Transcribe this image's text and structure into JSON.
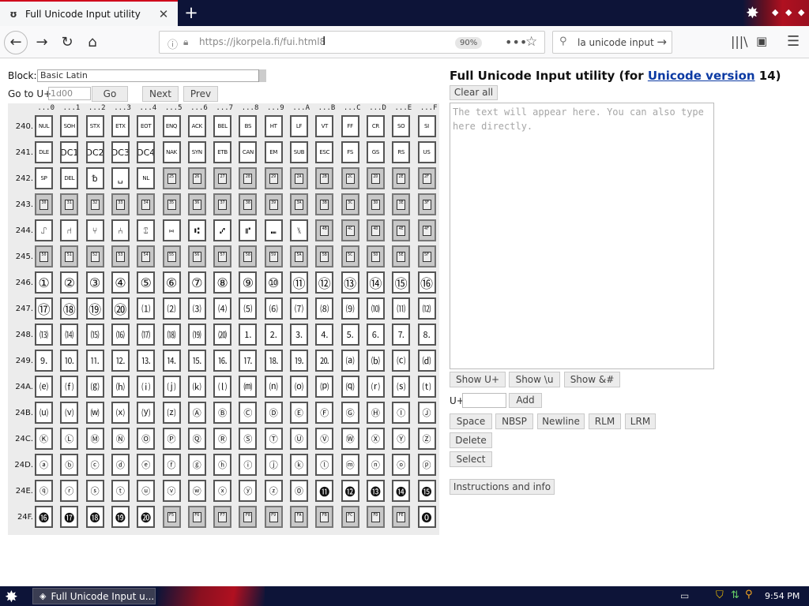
{
  "browser": {
    "tab_title": "Full Unicode Input utility",
    "url": "https://jkorpela.fi/fui.html8",
    "zoom": "90%",
    "search_text": "la unicode input"
  },
  "page": {
    "block_label": "Block:",
    "block_value": "Basic Latin",
    "goto_label": "Go to U+",
    "goto_placeholder": "1d00",
    "go_label": "Go",
    "next_label": "Next",
    "prev_label": "Prev",
    "title_prefix": "Full Unicode Input utility (for ",
    "title_link": "Unicode version",
    "title_suffix": " 14)",
    "clear_label": "Clear all",
    "textarea_placeholder": "The text will appear here. You can also type here directly.",
    "show_u_label": "Show U+",
    "show_esc_label": "Show \\u",
    "show_ent_label": "Show &#",
    "uplus_label": "U+",
    "add_label": "Add",
    "space_label": "Space",
    "nbsp_label": "NBSP",
    "newline_label": "Newline",
    "rlm_label": "RLM",
    "lrm_label": "LRM",
    "delete_label": "Delete",
    "select_label": "Select",
    "instructions_label": "Instructions and info"
  },
  "grid": {
    "col_headers": [
      "...0",
      "...1",
      "...2",
      "...3",
      "...4",
      "...5",
      "...6",
      "...7",
      "...8",
      "...9",
      "...A",
      "...B",
      "...C",
      "...D",
      "...E",
      "...F"
    ],
    "rows": [
      {
        "label": "240.",
        "cells": [
          "NUL",
          "SOH",
          "STX",
          "ETX",
          "EOT",
          "ENQ",
          "ACK",
          "BEL",
          "BS",
          "HT",
          "LF",
          "VT",
          "FF",
          "CR",
          "SO",
          "SI"
        ]
      },
      {
        "label": "241.",
        "cells": [
          "DLE",
          "DC1",
          "DC2",
          "DC3",
          "DC4",
          "NAK",
          "SYN",
          "ETB",
          "CAN",
          "EM",
          "SUB",
          "ESC",
          "FS",
          "GS",
          "RS",
          "US"
        ]
      },
      {
        "label": "242.",
        "cells": [
          "SP",
          "DEL",
          "␢",
          "␣",
          "NL",
          "#2425",
          "#2426",
          "#2427",
          "#2428",
          "#2429",
          "#242A",
          "#242B",
          "#242C",
          "#242D",
          "#242E",
          "#242F"
        ]
      },
      {
        "label": "243.",
        "cells": [
          "#2430",
          "#2431",
          "#2432",
          "#2433",
          "#2434",
          "#2435",
          "#2436",
          "#2437",
          "#2438",
          "#2439",
          "#243A",
          "#243B",
          "#243C",
          "#243D",
          "#243E",
          "#243F"
        ]
      },
      {
        "label": "244.",
        "cells": [
          "⑀",
          "⑁",
          "⑂",
          "⑃",
          "⑄",
          "⑅",
          "⑆",
          "⑇",
          "⑈",
          "⑉",
          "⑊",
          "#244B",
          "#244C",
          "#244D",
          "#244E",
          "#244F"
        ]
      },
      {
        "label": "245.",
        "cells": [
          "#2450",
          "#2451",
          "#2452",
          "#2453",
          "#2454",
          "#2455",
          "#2456",
          "#2457",
          "#2458",
          "#2459",
          "#245A",
          "#245B",
          "#245C",
          "#245D",
          "#245E",
          "#245F"
        ]
      },
      {
        "label": "246.",
        "cells": [
          "①",
          "②",
          "③",
          "④",
          "⑤",
          "⑥",
          "⑦",
          "⑧",
          "⑨",
          "⑩",
          "⑪",
          "⑫",
          "⑬",
          "⑭",
          "⑮",
          "⑯"
        ]
      },
      {
        "label": "247.",
        "cells": [
          "⑰",
          "⑱",
          "⑲",
          "⑳",
          "⑴",
          "⑵",
          "⑶",
          "⑷",
          "⑸",
          "⑹",
          "⑺",
          "⑻",
          "⑼",
          "⑽",
          "⑾",
          "⑿"
        ]
      },
      {
        "label": "248.",
        "cells": [
          "⒀",
          "⒁",
          "⒂",
          "⒃",
          "⒄",
          "⒅",
          "⒆",
          "⒇",
          "⒈",
          "⒉",
          "⒊",
          "⒋",
          "⒌",
          "⒍",
          "⒎",
          "⒏"
        ]
      },
      {
        "label": "249.",
        "cells": [
          "⒐",
          "⒑",
          "⒒",
          "⒓",
          "⒔",
          "⒕",
          "⒖",
          "⒗",
          "⒘",
          "⒙",
          "⒚",
          "⒛",
          "⒜",
          "⒝",
          "⒞",
          "⒟"
        ]
      },
      {
        "label": "24A.",
        "cells": [
          "⒠",
          "⒡",
          "⒢",
          "⒣",
          "⒤",
          "⒥",
          "⒦",
          "⒧",
          "⒨",
          "⒩",
          "⒪",
          "⒫",
          "⒬",
          "⒭",
          "⒮",
          "⒯"
        ]
      },
      {
        "label": "24B.",
        "cells": [
          "⒰",
          "⒱",
          "⒲",
          "⒳",
          "⒴",
          "⒵",
          "Ⓐ",
          "Ⓑ",
          "Ⓒ",
          "Ⓓ",
          "Ⓔ",
          "Ⓕ",
          "Ⓖ",
          "Ⓗ",
          "Ⓘ",
          "Ⓙ"
        ]
      },
      {
        "label": "24C.",
        "cells": [
          "Ⓚ",
          "Ⓛ",
          "Ⓜ",
          "Ⓝ",
          "Ⓞ",
          "Ⓟ",
          "Ⓠ",
          "Ⓡ",
          "Ⓢ",
          "Ⓣ",
          "Ⓤ",
          "Ⓥ",
          "Ⓦ",
          "Ⓧ",
          "Ⓨ",
          "Ⓩ"
        ]
      },
      {
        "label": "24D.",
        "cells": [
          "ⓐ",
          "ⓑ",
          "ⓒ",
          "ⓓ",
          "ⓔ",
          "ⓕ",
          "ⓖ",
          "ⓗ",
          "ⓘ",
          "ⓙ",
          "ⓚ",
          "ⓛ",
          "ⓜ",
          "ⓝ",
          "ⓞ",
          "ⓟ"
        ]
      },
      {
        "label": "24E.",
        "cells": [
          "ⓠ",
          "ⓡ",
          "ⓢ",
          "ⓣ",
          "ⓤ",
          "ⓥ",
          "ⓦ",
          "ⓧ",
          "ⓨ",
          "ⓩ",
          "⓪",
          "⓫",
          "⓬",
          "⓭",
          "⓮",
          "⓯"
        ]
      },
      {
        "label": "24F.",
        "cells": [
          "⓰",
          "⓱",
          "⓲",
          "⓳",
          "⓴",
          "#24F5",
          "#24F6",
          "#24F7",
          "#24F8",
          "#24F9",
          "#24FA",
          "#24FB",
          "#24FC",
          "#24FD",
          "#24FE",
          "⓿"
        ]
      }
    ]
  },
  "taskbar": {
    "task_label": "Full Unicode Input u...",
    "clock": "9:54 PM"
  },
  "icons": {
    "tab": "firefox-page-icon",
    "back": "arrow-left",
    "forward": "arrow-right",
    "reload": "reload",
    "home": "home",
    "library": "library",
    "sidebar": "sidebar",
    "menu": "hamburger"
  },
  "colors": {
    "titlebar": "#0d1438",
    "accent_red": "#b01020",
    "link": "#0b3aa3",
    "unassigned_cell": "#c8c8c8"
  }
}
